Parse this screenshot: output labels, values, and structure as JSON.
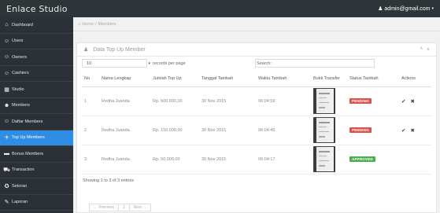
{
  "app": {
    "title": "Enlace Studio",
    "user_email": "admin@gmail.com",
    "user_caret": "▾"
  },
  "sidebar": {
    "items": [
      {
        "label": "Dashboard",
        "icon": "dashboard-icon",
        "glyph": "⌂"
      },
      {
        "label": "Users",
        "icon": "users-icon",
        "glyph": "☺"
      },
      {
        "label": "Owners",
        "icon": "owners-icon",
        "glyph": "☺"
      },
      {
        "label": "Cashiers",
        "icon": "cashiers-icon",
        "glyph": "☺"
      },
      {
        "label": "Studio",
        "icon": "studio-icon",
        "glyph": "▦"
      },
      {
        "label": "Members",
        "icon": "members-icon",
        "glyph": "☻"
      },
      {
        "label": "Daftar Members",
        "icon": "members-list-icon",
        "glyph": "☺"
      },
      {
        "label": "Top Up Members",
        "icon": "top-up-icon",
        "glyph": "✈"
      },
      {
        "label": "Bonus Members",
        "icon": "bonus-icon",
        "glyph": "▬"
      },
      {
        "label": "Transaction",
        "icon": "cart-icon",
        "glyph": "⛟"
      },
      {
        "label": "Setoran",
        "icon": "setoran-icon",
        "glyph": "✪"
      },
      {
        "label": "Laporan",
        "icon": "report-icon",
        "glyph": "✎"
      }
    ],
    "active_index": 7
  },
  "breadcrumb": {
    "home_icon": "home-icon",
    "home": "Home",
    "separator": "/",
    "current": "Members"
  },
  "panel": {
    "title_icon": "user-icon",
    "title": "Data Top Up Member",
    "tool_collapse": "^",
    "tool_close": "×"
  },
  "controls": {
    "page_size": "10",
    "page_size_caret": "▾",
    "records_per_page": "records per page",
    "search_label": "Search:",
    "search_value": ""
  },
  "table": {
    "headers": {
      "no": "No",
      "nama": "Nama Lengkap",
      "jumlah": "Jumlah Top Up",
      "tanggal": "Tanggal Tambah",
      "waktu": "Waktu Tambah",
      "bukti": "Bukti Transfer",
      "status": "Status Tambah",
      "actions": "Actions"
    },
    "rows": [
      {
        "no": "1",
        "nama": "Redha Juanda",
        "jumlah": "Rp. 500.000,00",
        "tanggal": "30 Nov 2015",
        "waktu": "06:04:59",
        "status": "PENDING",
        "approve": "✔",
        "reject": "✖"
      },
      {
        "no": "2",
        "nama": "Redha Juanda",
        "jumlah": "Rp. 150.000,00",
        "tanggal": "30 Nov 2015",
        "waktu": "06:04:45",
        "status": "PENDING",
        "approve": "✔",
        "reject": "✖"
      },
      {
        "no": "3",
        "nama": "Redha Juanda",
        "jumlah": "Rp. 50.000,00",
        "tanggal": "30 Nov 2015",
        "waktu": "06:04:17",
        "status": "APPROVED",
        "approve": "",
        "reject": ""
      }
    ]
  },
  "footer": {
    "info": "Showing 1 to 3 of 3 entries",
    "previous": "← Previous",
    "page": "1",
    "next": "Next →"
  },
  "colors": {
    "accent": "#2f8de4",
    "pending": "#d9534f",
    "approved": "#4cae4c",
    "sidebar": "#2b3136",
    "topbar": "#2e3539"
  }
}
